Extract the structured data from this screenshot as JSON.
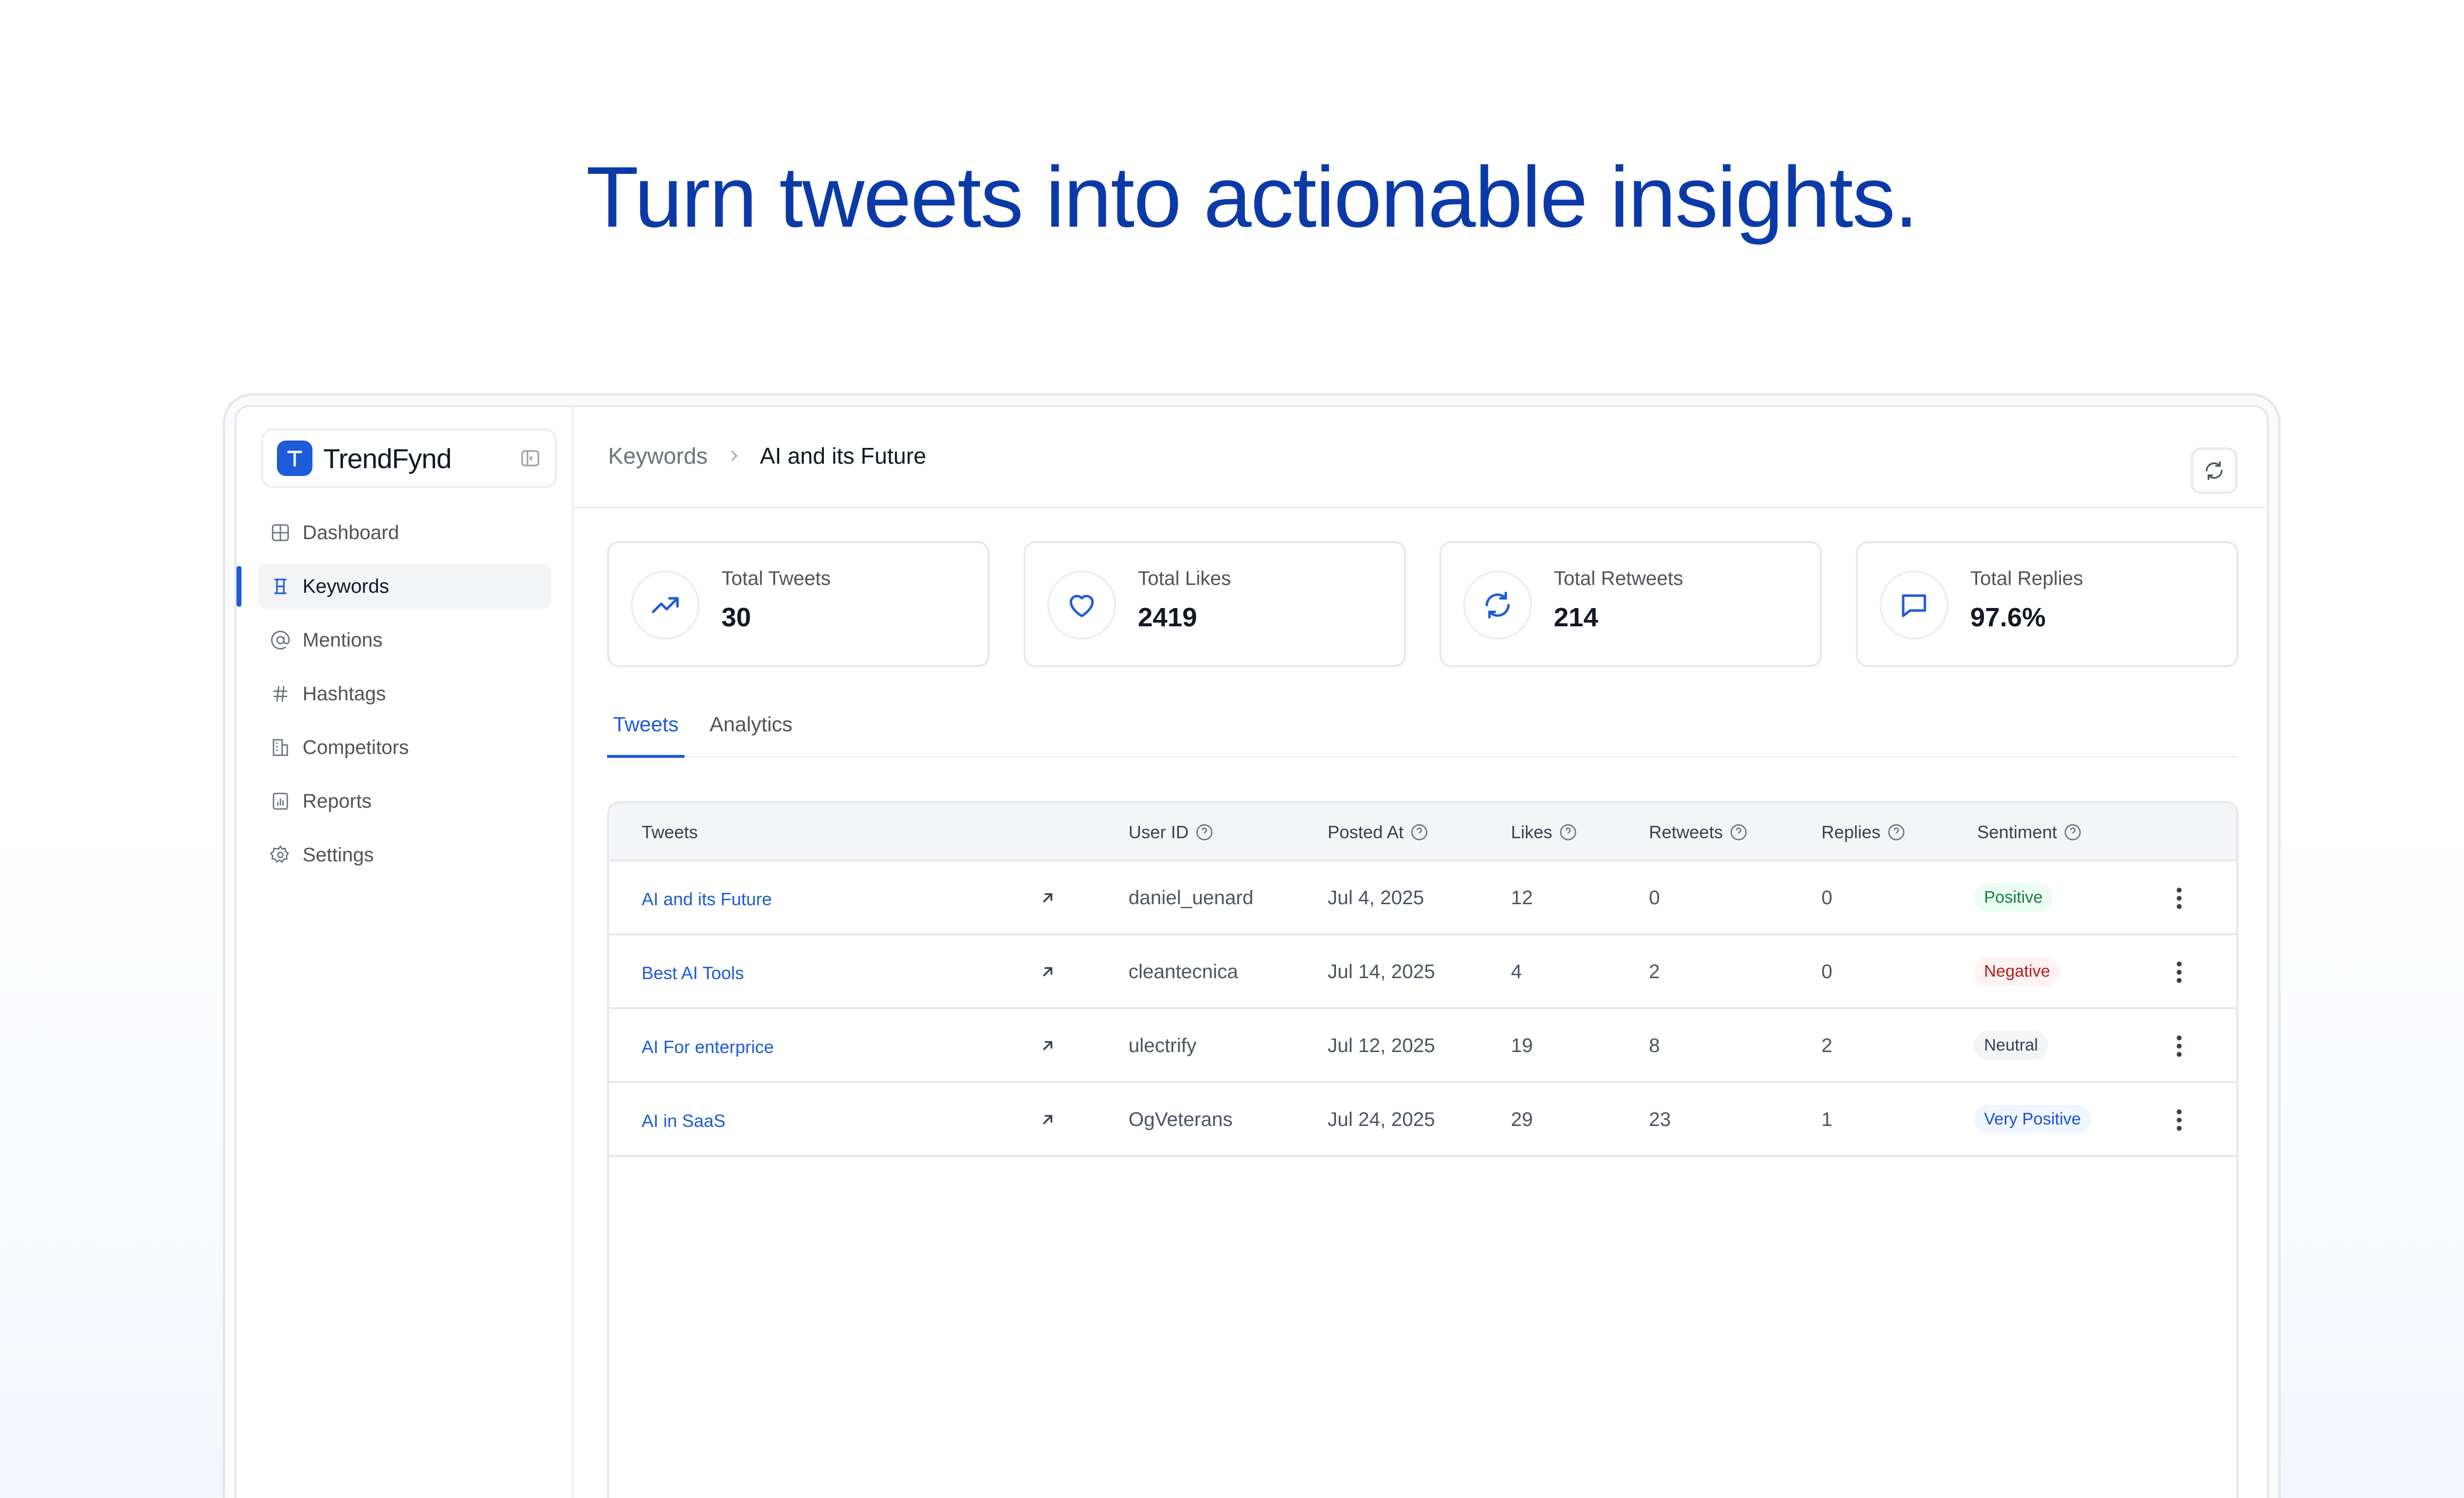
{
  "hero": {
    "headline": "Turn tweets into actionable insights."
  },
  "brand": {
    "name": "TrendFynd",
    "logo_icon": "arrow-up-logo-icon",
    "accent": "#1d5bd8"
  },
  "sidebar": {
    "items": [
      {
        "label": "Dashboard",
        "icon": "grid-icon",
        "active": false
      },
      {
        "label": "Keywords",
        "icon": "keyword-icon",
        "active": true
      },
      {
        "label": "Mentions",
        "icon": "at-icon",
        "active": false
      },
      {
        "label": "Hashtags",
        "icon": "hash-icon",
        "active": false
      },
      {
        "label": "Competitors",
        "icon": "building-icon",
        "active": false
      },
      {
        "label": "Reports",
        "icon": "report-icon",
        "active": false
      },
      {
        "label": "Settings",
        "icon": "gear-icon",
        "active": false
      }
    ]
  },
  "breadcrumb": {
    "parent": "Keywords",
    "current": "AI and its Future"
  },
  "stats": [
    {
      "label": "Total Tweets",
      "value": "30",
      "icon": "trending-up-icon"
    },
    {
      "label": "Total Likes",
      "value": "2419",
      "icon": "heart-icon"
    },
    {
      "label": "Total Retweets",
      "value": "214",
      "icon": "retweet-icon"
    },
    {
      "label": "Total Replies",
      "value": "97.6%",
      "icon": "chat-icon"
    }
  ],
  "tabs": [
    {
      "label": "Tweets",
      "active": true
    },
    {
      "label": "Analytics",
      "active": false
    }
  ],
  "table": {
    "headers": [
      "Tweets",
      "User ID",
      "Posted At",
      "Likes",
      "Retweets",
      "Replies",
      "Sentiment"
    ],
    "rows": [
      {
        "tweet": "AI and its Future",
        "user": "daniel_uenard",
        "posted": "Jul 4, 2025",
        "likes": "12",
        "retweets": "0",
        "replies": "0",
        "sentiment": "Positive",
        "sentiment_type": "positive"
      },
      {
        "tweet": "Best AI Tools",
        "user": "cleantecnica",
        "posted": "Jul 14, 2025",
        "likes": "4",
        "retweets": "2",
        "replies": "0",
        "sentiment": "Negative",
        "sentiment_type": "negative"
      },
      {
        "tweet": "AI For enterprice",
        "user": "ulectrify",
        "posted": "Jul 12, 2025",
        "likes": "19",
        "retweets": "8",
        "replies": "2",
        "sentiment": "Neutral",
        "sentiment_type": "neutral"
      },
      {
        "tweet": "AI in SaaS",
        "user": "OgVeterans",
        "posted": "Jul 24, 2025",
        "likes": "29",
        "retweets": "23",
        "replies": "1",
        "sentiment": "Very Positive",
        "sentiment_type": "vpositive"
      }
    ]
  }
}
